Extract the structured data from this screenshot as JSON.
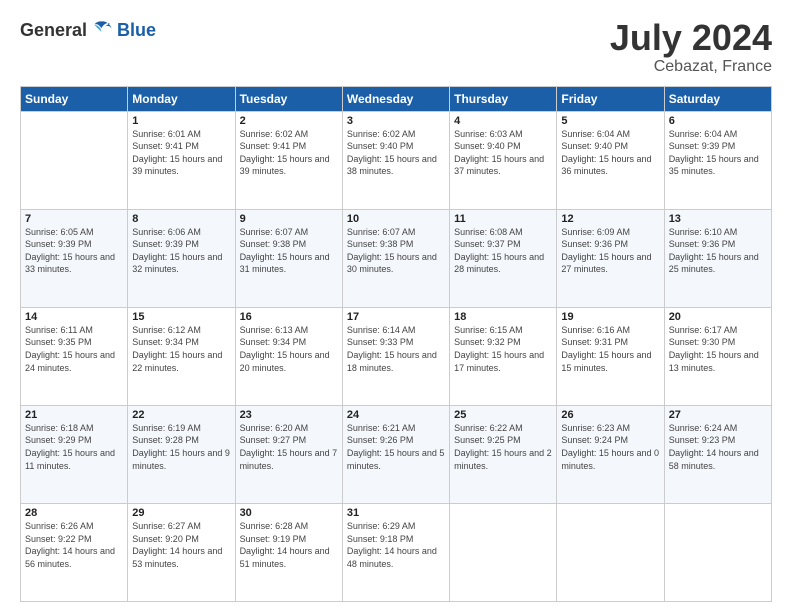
{
  "header": {
    "logo_general": "General",
    "logo_blue": "Blue",
    "month": "July 2024",
    "location": "Cebazat, France"
  },
  "weekdays": [
    "Sunday",
    "Monday",
    "Tuesday",
    "Wednesday",
    "Thursday",
    "Friday",
    "Saturday"
  ],
  "weeks": [
    [
      {
        "day": "",
        "empty": true
      },
      {
        "day": "1",
        "sunrise": "Sunrise: 6:01 AM",
        "sunset": "Sunset: 9:41 PM",
        "daylight": "Daylight: 15 hours and 39 minutes."
      },
      {
        "day": "2",
        "sunrise": "Sunrise: 6:02 AM",
        "sunset": "Sunset: 9:41 PM",
        "daylight": "Daylight: 15 hours and 39 minutes."
      },
      {
        "day": "3",
        "sunrise": "Sunrise: 6:02 AM",
        "sunset": "Sunset: 9:40 PM",
        "daylight": "Daylight: 15 hours and 38 minutes."
      },
      {
        "day": "4",
        "sunrise": "Sunrise: 6:03 AM",
        "sunset": "Sunset: 9:40 PM",
        "daylight": "Daylight: 15 hours and 37 minutes."
      },
      {
        "day": "5",
        "sunrise": "Sunrise: 6:04 AM",
        "sunset": "Sunset: 9:40 PM",
        "daylight": "Daylight: 15 hours and 36 minutes."
      },
      {
        "day": "6",
        "sunrise": "Sunrise: 6:04 AM",
        "sunset": "Sunset: 9:39 PM",
        "daylight": "Daylight: 15 hours and 35 minutes."
      }
    ],
    [
      {
        "day": "7",
        "sunrise": "Sunrise: 6:05 AM",
        "sunset": "Sunset: 9:39 PM",
        "daylight": "Daylight: 15 hours and 33 minutes."
      },
      {
        "day": "8",
        "sunrise": "Sunrise: 6:06 AM",
        "sunset": "Sunset: 9:39 PM",
        "daylight": "Daylight: 15 hours and 32 minutes."
      },
      {
        "day": "9",
        "sunrise": "Sunrise: 6:07 AM",
        "sunset": "Sunset: 9:38 PM",
        "daylight": "Daylight: 15 hours and 31 minutes."
      },
      {
        "day": "10",
        "sunrise": "Sunrise: 6:07 AM",
        "sunset": "Sunset: 9:38 PM",
        "daylight": "Daylight: 15 hours and 30 minutes."
      },
      {
        "day": "11",
        "sunrise": "Sunrise: 6:08 AM",
        "sunset": "Sunset: 9:37 PM",
        "daylight": "Daylight: 15 hours and 28 minutes."
      },
      {
        "day": "12",
        "sunrise": "Sunrise: 6:09 AM",
        "sunset": "Sunset: 9:36 PM",
        "daylight": "Daylight: 15 hours and 27 minutes."
      },
      {
        "day": "13",
        "sunrise": "Sunrise: 6:10 AM",
        "sunset": "Sunset: 9:36 PM",
        "daylight": "Daylight: 15 hours and 25 minutes."
      }
    ],
    [
      {
        "day": "14",
        "sunrise": "Sunrise: 6:11 AM",
        "sunset": "Sunset: 9:35 PM",
        "daylight": "Daylight: 15 hours and 24 minutes."
      },
      {
        "day": "15",
        "sunrise": "Sunrise: 6:12 AM",
        "sunset": "Sunset: 9:34 PM",
        "daylight": "Daylight: 15 hours and 22 minutes."
      },
      {
        "day": "16",
        "sunrise": "Sunrise: 6:13 AM",
        "sunset": "Sunset: 9:34 PM",
        "daylight": "Daylight: 15 hours and 20 minutes."
      },
      {
        "day": "17",
        "sunrise": "Sunrise: 6:14 AM",
        "sunset": "Sunset: 9:33 PM",
        "daylight": "Daylight: 15 hours and 18 minutes."
      },
      {
        "day": "18",
        "sunrise": "Sunrise: 6:15 AM",
        "sunset": "Sunset: 9:32 PM",
        "daylight": "Daylight: 15 hours and 17 minutes."
      },
      {
        "day": "19",
        "sunrise": "Sunrise: 6:16 AM",
        "sunset": "Sunset: 9:31 PM",
        "daylight": "Daylight: 15 hours and 15 minutes."
      },
      {
        "day": "20",
        "sunrise": "Sunrise: 6:17 AM",
        "sunset": "Sunset: 9:30 PM",
        "daylight": "Daylight: 15 hours and 13 minutes."
      }
    ],
    [
      {
        "day": "21",
        "sunrise": "Sunrise: 6:18 AM",
        "sunset": "Sunset: 9:29 PM",
        "daylight": "Daylight: 15 hours and 11 minutes."
      },
      {
        "day": "22",
        "sunrise": "Sunrise: 6:19 AM",
        "sunset": "Sunset: 9:28 PM",
        "daylight": "Daylight: 15 hours and 9 minutes."
      },
      {
        "day": "23",
        "sunrise": "Sunrise: 6:20 AM",
        "sunset": "Sunset: 9:27 PM",
        "daylight": "Daylight: 15 hours and 7 minutes."
      },
      {
        "day": "24",
        "sunrise": "Sunrise: 6:21 AM",
        "sunset": "Sunset: 9:26 PM",
        "daylight": "Daylight: 15 hours and 5 minutes."
      },
      {
        "day": "25",
        "sunrise": "Sunrise: 6:22 AM",
        "sunset": "Sunset: 9:25 PM",
        "daylight": "Daylight: 15 hours and 2 minutes."
      },
      {
        "day": "26",
        "sunrise": "Sunrise: 6:23 AM",
        "sunset": "Sunset: 9:24 PM",
        "daylight": "Daylight: 15 hours and 0 minutes."
      },
      {
        "day": "27",
        "sunrise": "Sunrise: 6:24 AM",
        "sunset": "Sunset: 9:23 PM",
        "daylight": "Daylight: 14 hours and 58 minutes."
      }
    ],
    [
      {
        "day": "28",
        "sunrise": "Sunrise: 6:26 AM",
        "sunset": "Sunset: 9:22 PM",
        "daylight": "Daylight: 14 hours and 56 minutes."
      },
      {
        "day": "29",
        "sunrise": "Sunrise: 6:27 AM",
        "sunset": "Sunset: 9:20 PM",
        "daylight": "Daylight: 14 hours and 53 minutes."
      },
      {
        "day": "30",
        "sunrise": "Sunrise: 6:28 AM",
        "sunset": "Sunset: 9:19 PM",
        "daylight": "Daylight: 14 hours and 51 minutes."
      },
      {
        "day": "31",
        "sunrise": "Sunrise: 6:29 AM",
        "sunset": "Sunset: 9:18 PM",
        "daylight": "Daylight: 14 hours and 48 minutes."
      },
      {
        "day": "",
        "empty": true
      },
      {
        "day": "",
        "empty": true
      },
      {
        "day": "",
        "empty": true
      }
    ]
  ]
}
